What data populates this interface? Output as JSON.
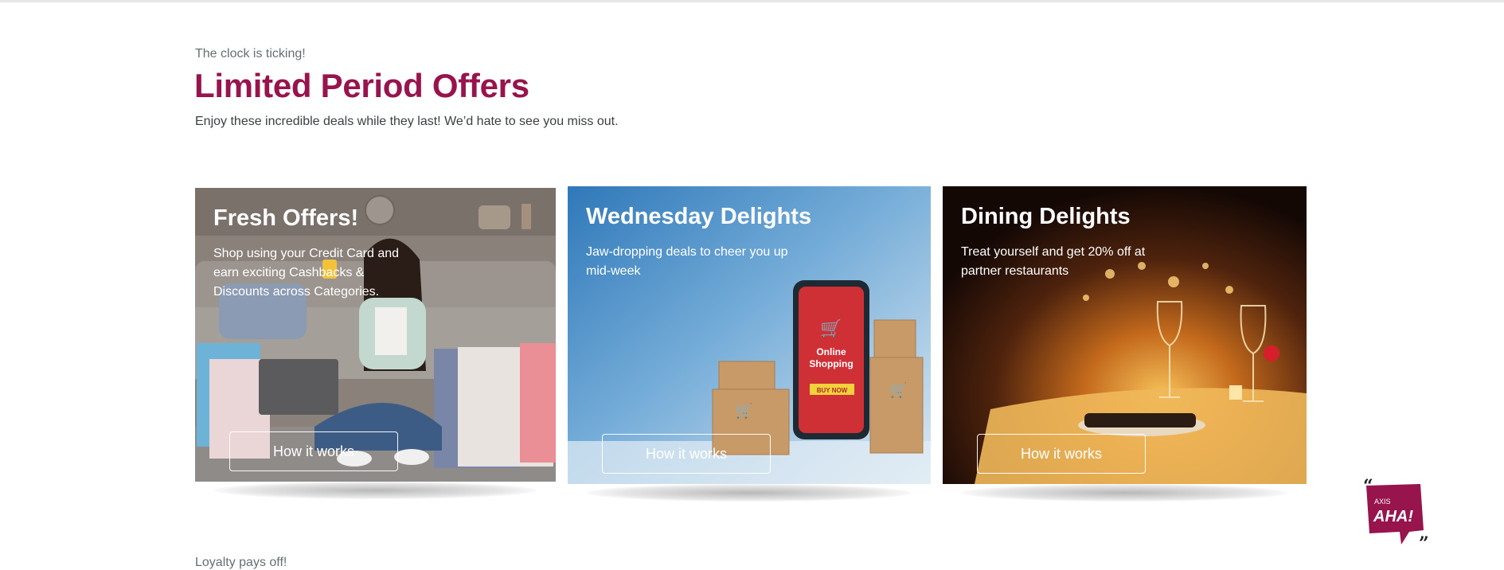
{
  "section": {
    "eyebrow": "The clock is ticking!",
    "title": "Limited Period Offers",
    "subtitle": "Enjoy these incredible deals while they last! We’d hate to see you miss out."
  },
  "cards": [
    {
      "title": "Fresh Offers!",
      "description": "Shop using your Credit Card and earn exciting Cashbacks & Discounts across Categories.",
      "button_label": "How it works"
    },
    {
      "title": "Wednesday Delights",
      "description": "Jaw-dropping deals to cheer you up mid-week",
      "button_label": "How it works",
      "phone_text": [
        "Online",
        "Shopping"
      ],
      "phone_button": "BUY NOW"
    },
    {
      "title": "Dining Delights",
      "description": "Treat yourself and get 20% off at partner restaurants",
      "button_label": "How it works"
    }
  ],
  "next_section": {
    "eyebrow": "Loyalty pays off!"
  },
  "widget": {
    "brand_small": "AXIS",
    "brand_large": "AHA!"
  },
  "colors": {
    "accent": "#97144d",
    "text_muted": "#666f73",
    "text_body": "#3b3f42"
  }
}
